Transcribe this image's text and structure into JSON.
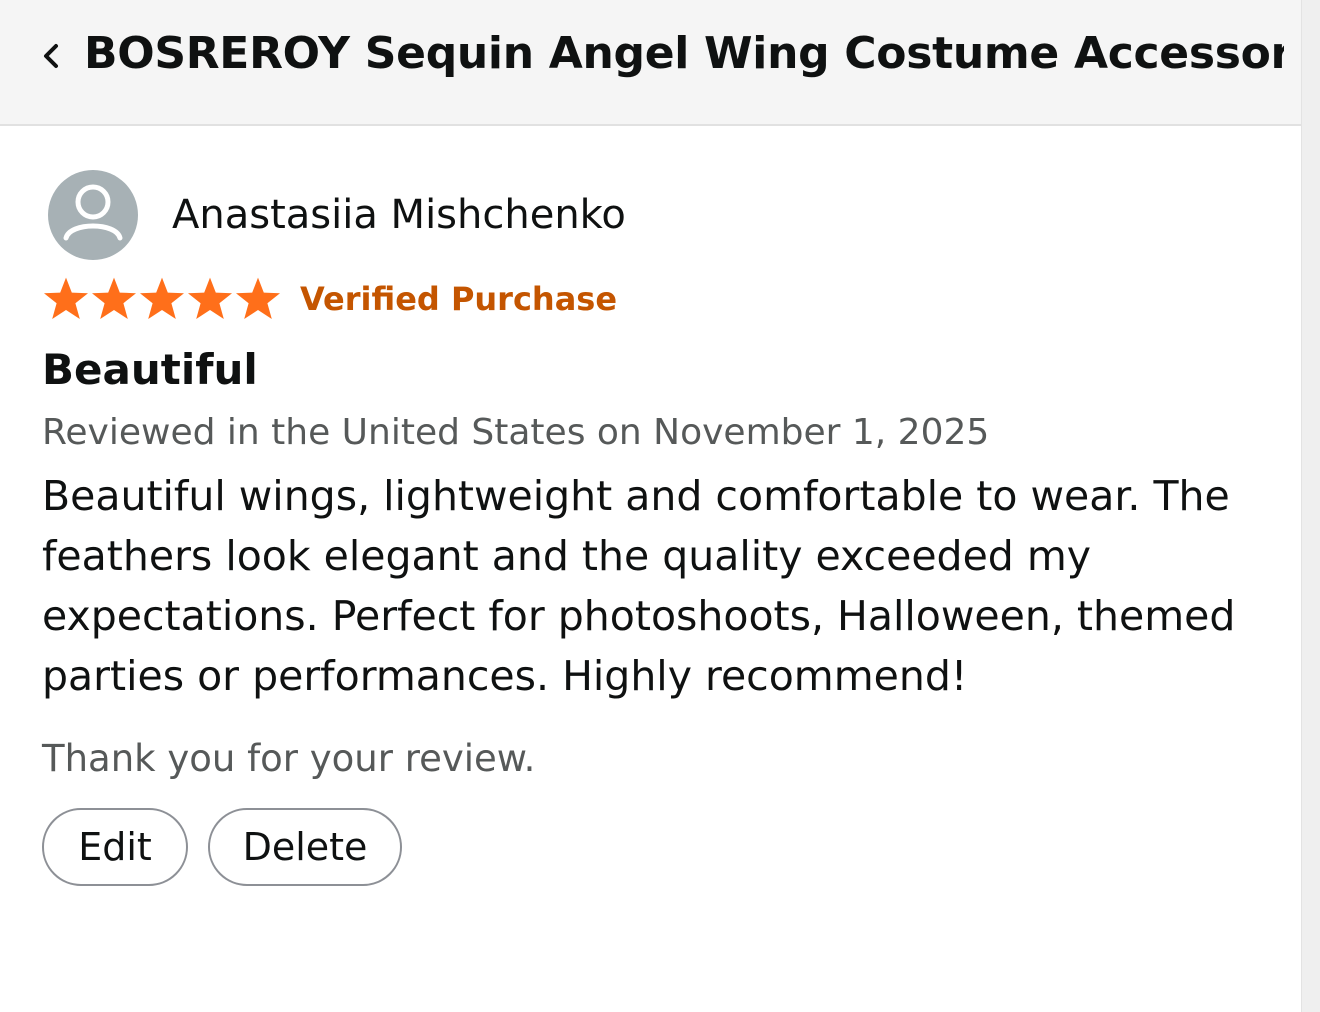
{
  "header": {
    "title": "BOSREROY Sequin Angel Wing Costume Accessory...",
    "back_icon": "chevron-left-icon"
  },
  "review": {
    "reviewer_name": "Anastasiia Mishchenko",
    "avatar_icon": "default-user-avatar-icon",
    "rating": 5,
    "rating_max": 5,
    "verified_label": "Verified Purchase",
    "title": "Beautiful",
    "date_text": "Reviewed in the United States on November 1, 2025",
    "body": "Beautiful wings, lightweight and comfortable to wear. The feathers look elegant and the quality exceeded my expectations. Perfect for photoshoots, Halloween, themed parties or performances. Highly recommend!",
    "thanks_text": "Thank you for your review."
  },
  "actions": {
    "edit_label": "Edit",
    "delete_label": "Delete"
  },
  "colors": {
    "star": "#ff6f1a",
    "verified": "#c45500",
    "header_bg": "#f5f5f5",
    "avatar_bg": "#a7b1b5",
    "muted_text": "#565959"
  }
}
